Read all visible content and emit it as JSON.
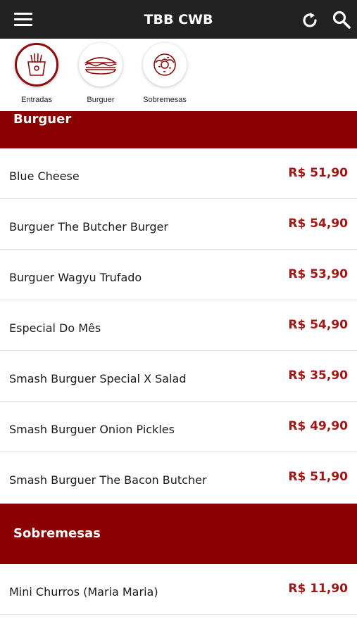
{
  "header": {
    "title": "TBB CWB"
  },
  "categories": [
    {
      "label": "Entradas",
      "icon": "fries-icon",
      "active": true
    },
    {
      "label": "Burguer",
      "icon": "sandwich-icon",
      "active": false
    },
    {
      "label": "Sobremesas",
      "icon": "donut-icon",
      "active": false
    }
  ],
  "sections": [
    {
      "title": "Burguer",
      "items": [
        {
          "name": "Blue Cheese",
          "price": "R$ 51,90"
        },
        {
          "name": "Burguer The Butcher Burger",
          "price": "R$ 54,90"
        },
        {
          "name": "Burguer Wagyu Trufado",
          "price": "R$ 53,90"
        },
        {
          "name": "Especial Do Mês",
          "price": "R$ 54,90"
        },
        {
          "name": "Smash Burguer Special X Salad",
          "price": "R$ 35,90"
        },
        {
          "name": "Smash Burguer Onion Pickles",
          "price": "R$ 49,90"
        },
        {
          "name": "Smash Burguer The Bacon Butcher",
          "price": "R$ 51,90"
        }
      ]
    },
    {
      "title": "Sobremesas",
      "items": [
        {
          "name": "Mini Churros (Maria Maria)",
          "price": "R$ 11,90"
        }
      ]
    }
  ],
  "colors": {
    "header_bg": "#222222",
    "section_bg": "#8b0000",
    "price": "#a31515"
  }
}
